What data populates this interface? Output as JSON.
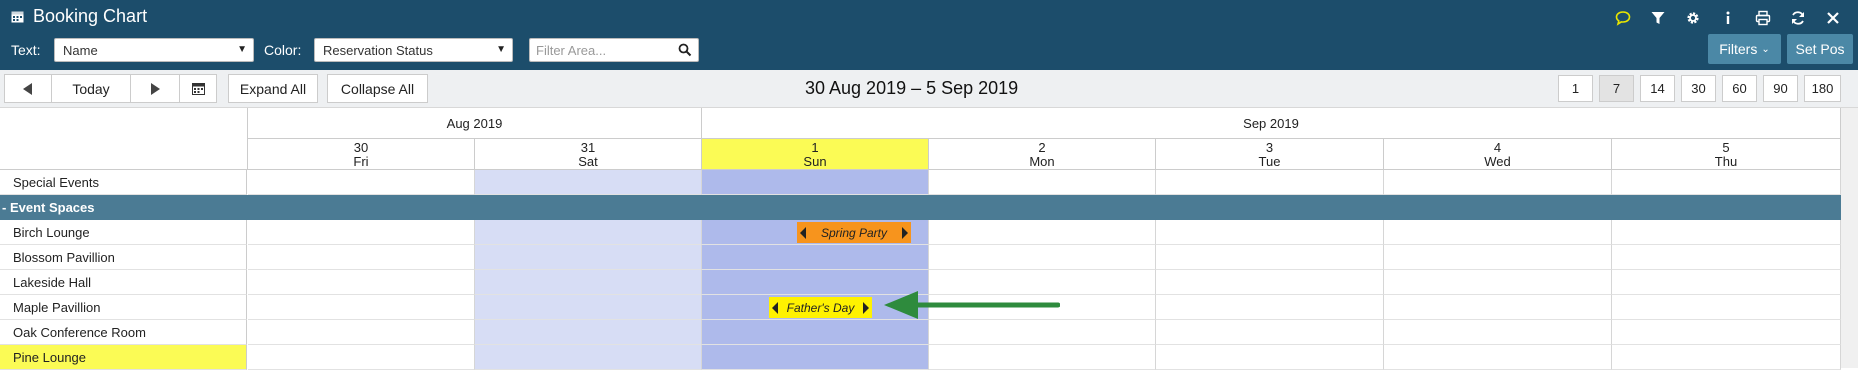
{
  "app": {
    "title": "Booking Chart"
  },
  "header": {
    "icons": [
      "comment-icon",
      "filter-icon",
      "gear-icon",
      "info-icon",
      "print-icon",
      "refresh-icon",
      "close-icon"
    ],
    "text_label": "Text:",
    "text_select_value": "Name",
    "color_label": "Color:",
    "color_select_value": "Reservation Status",
    "filter_placeholder": "Filter Area...",
    "filters_button": "Filters",
    "set_pos_button": "Set Pos"
  },
  "toolbar": {
    "today_label": "Today",
    "expand_label": "Expand All",
    "collapse_label": "Collapse All",
    "range_title": "30 Aug 2019 – 5 Sep 2019",
    "zoom_options": [
      "1",
      "7",
      "14",
      "30",
      "60",
      "90",
      "180"
    ],
    "zoom_selected": "7"
  },
  "calendar": {
    "months": [
      "Aug 2019",
      "Sep 2019"
    ],
    "days": [
      {
        "num": "30",
        "dow": "Fri"
      },
      {
        "num": "31",
        "dow": "Sat"
      },
      {
        "num": "1",
        "dow": "Sun"
      },
      {
        "num": "2",
        "dow": "Mon"
      },
      {
        "num": "3",
        "dow": "Tue"
      },
      {
        "num": "4",
        "dow": "Wed"
      },
      {
        "num": "5",
        "dow": "Thu"
      }
    ],
    "today_index": 2
  },
  "rows": {
    "special_events": "Special Events",
    "group": "- Event Spaces",
    "spaces": [
      "Birch Lounge",
      "Blossom Pavillion",
      "Lakeside Hall",
      "Maple Pavillion",
      "Oak Conference Room",
      "Pine Lounge"
    ],
    "highlighted_space": "Pine Lounge"
  },
  "events": {
    "spring_party": {
      "label": "Spring Party",
      "color": "#f7941d"
    },
    "fathers_day": {
      "label": "Father's Day",
      "color": "#fff200"
    }
  },
  "colors": {
    "header_bg": "#1c4d6b",
    "group_row": "#4b7b94",
    "today_highlight": "#fbfb55",
    "weekend_sat": "#d7ddf5",
    "weekend_sun": "#aebaeb",
    "arrow": "#2e8b3d"
  }
}
